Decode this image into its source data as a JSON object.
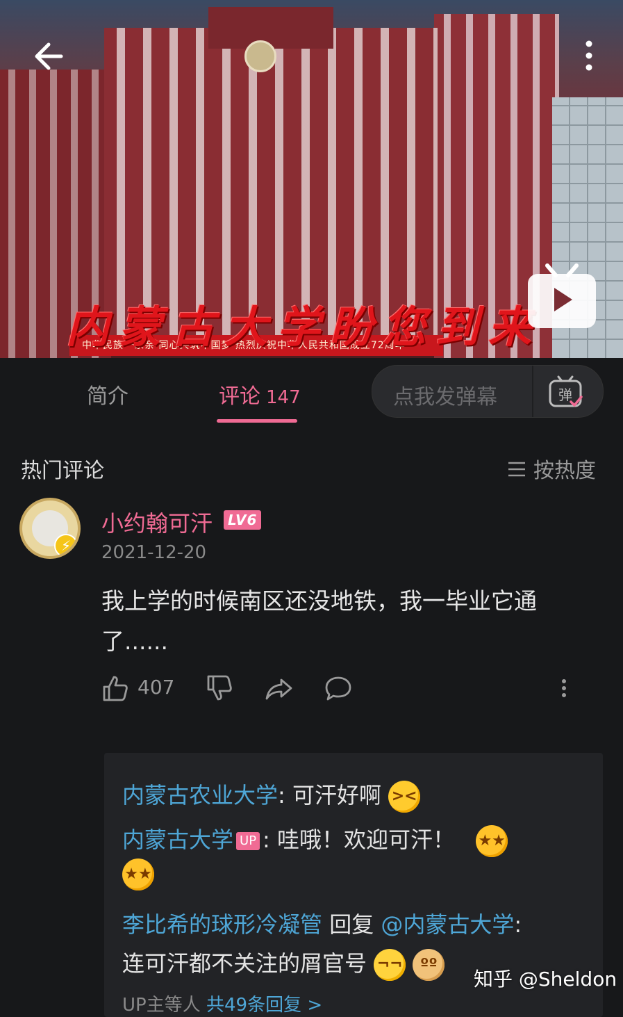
{
  "video": {
    "overlay_title": "内蒙古大学盼您到来",
    "banner_text": "中华民族一家亲 同心共筑中国梦 热烈庆祝中华人民共和国成立72周年"
  },
  "tabs": {
    "intro": "简介",
    "comments": "评论",
    "comments_count": "147"
  },
  "danmu": {
    "placeholder": "点我发弹幕",
    "icon_label": "弹"
  },
  "section": {
    "title": "热门评论",
    "sort_label": "按热度"
  },
  "comment": {
    "username": "小约翰可汗",
    "level": "LV6",
    "date": "2021-12-20",
    "text": "我上学的时候南区还没地铁，我一毕业它通了......",
    "likes": "407"
  },
  "replies": [
    {
      "name": "内蒙古农业大学",
      "text": ": 可汗好啊"
    },
    {
      "name": "内蒙古大学",
      "tag": "UP",
      "text": ": 哇哦！欢迎可汗！"
    },
    {
      "name": "李比希的球形冷凝管",
      "mid": " 回复 ",
      "target": "@内蒙古大学",
      "text": ":",
      "text2": "连可汗都不关注的屑官号"
    }
  ],
  "more_replies": {
    "prefix": "UP主等人 ",
    "link": "共49条回复 >"
  },
  "watermark": "知乎 @Sheldon",
  "colors": {
    "accent": "#f06b94",
    "link": "#4ea6d6",
    "background": "#17181a"
  }
}
